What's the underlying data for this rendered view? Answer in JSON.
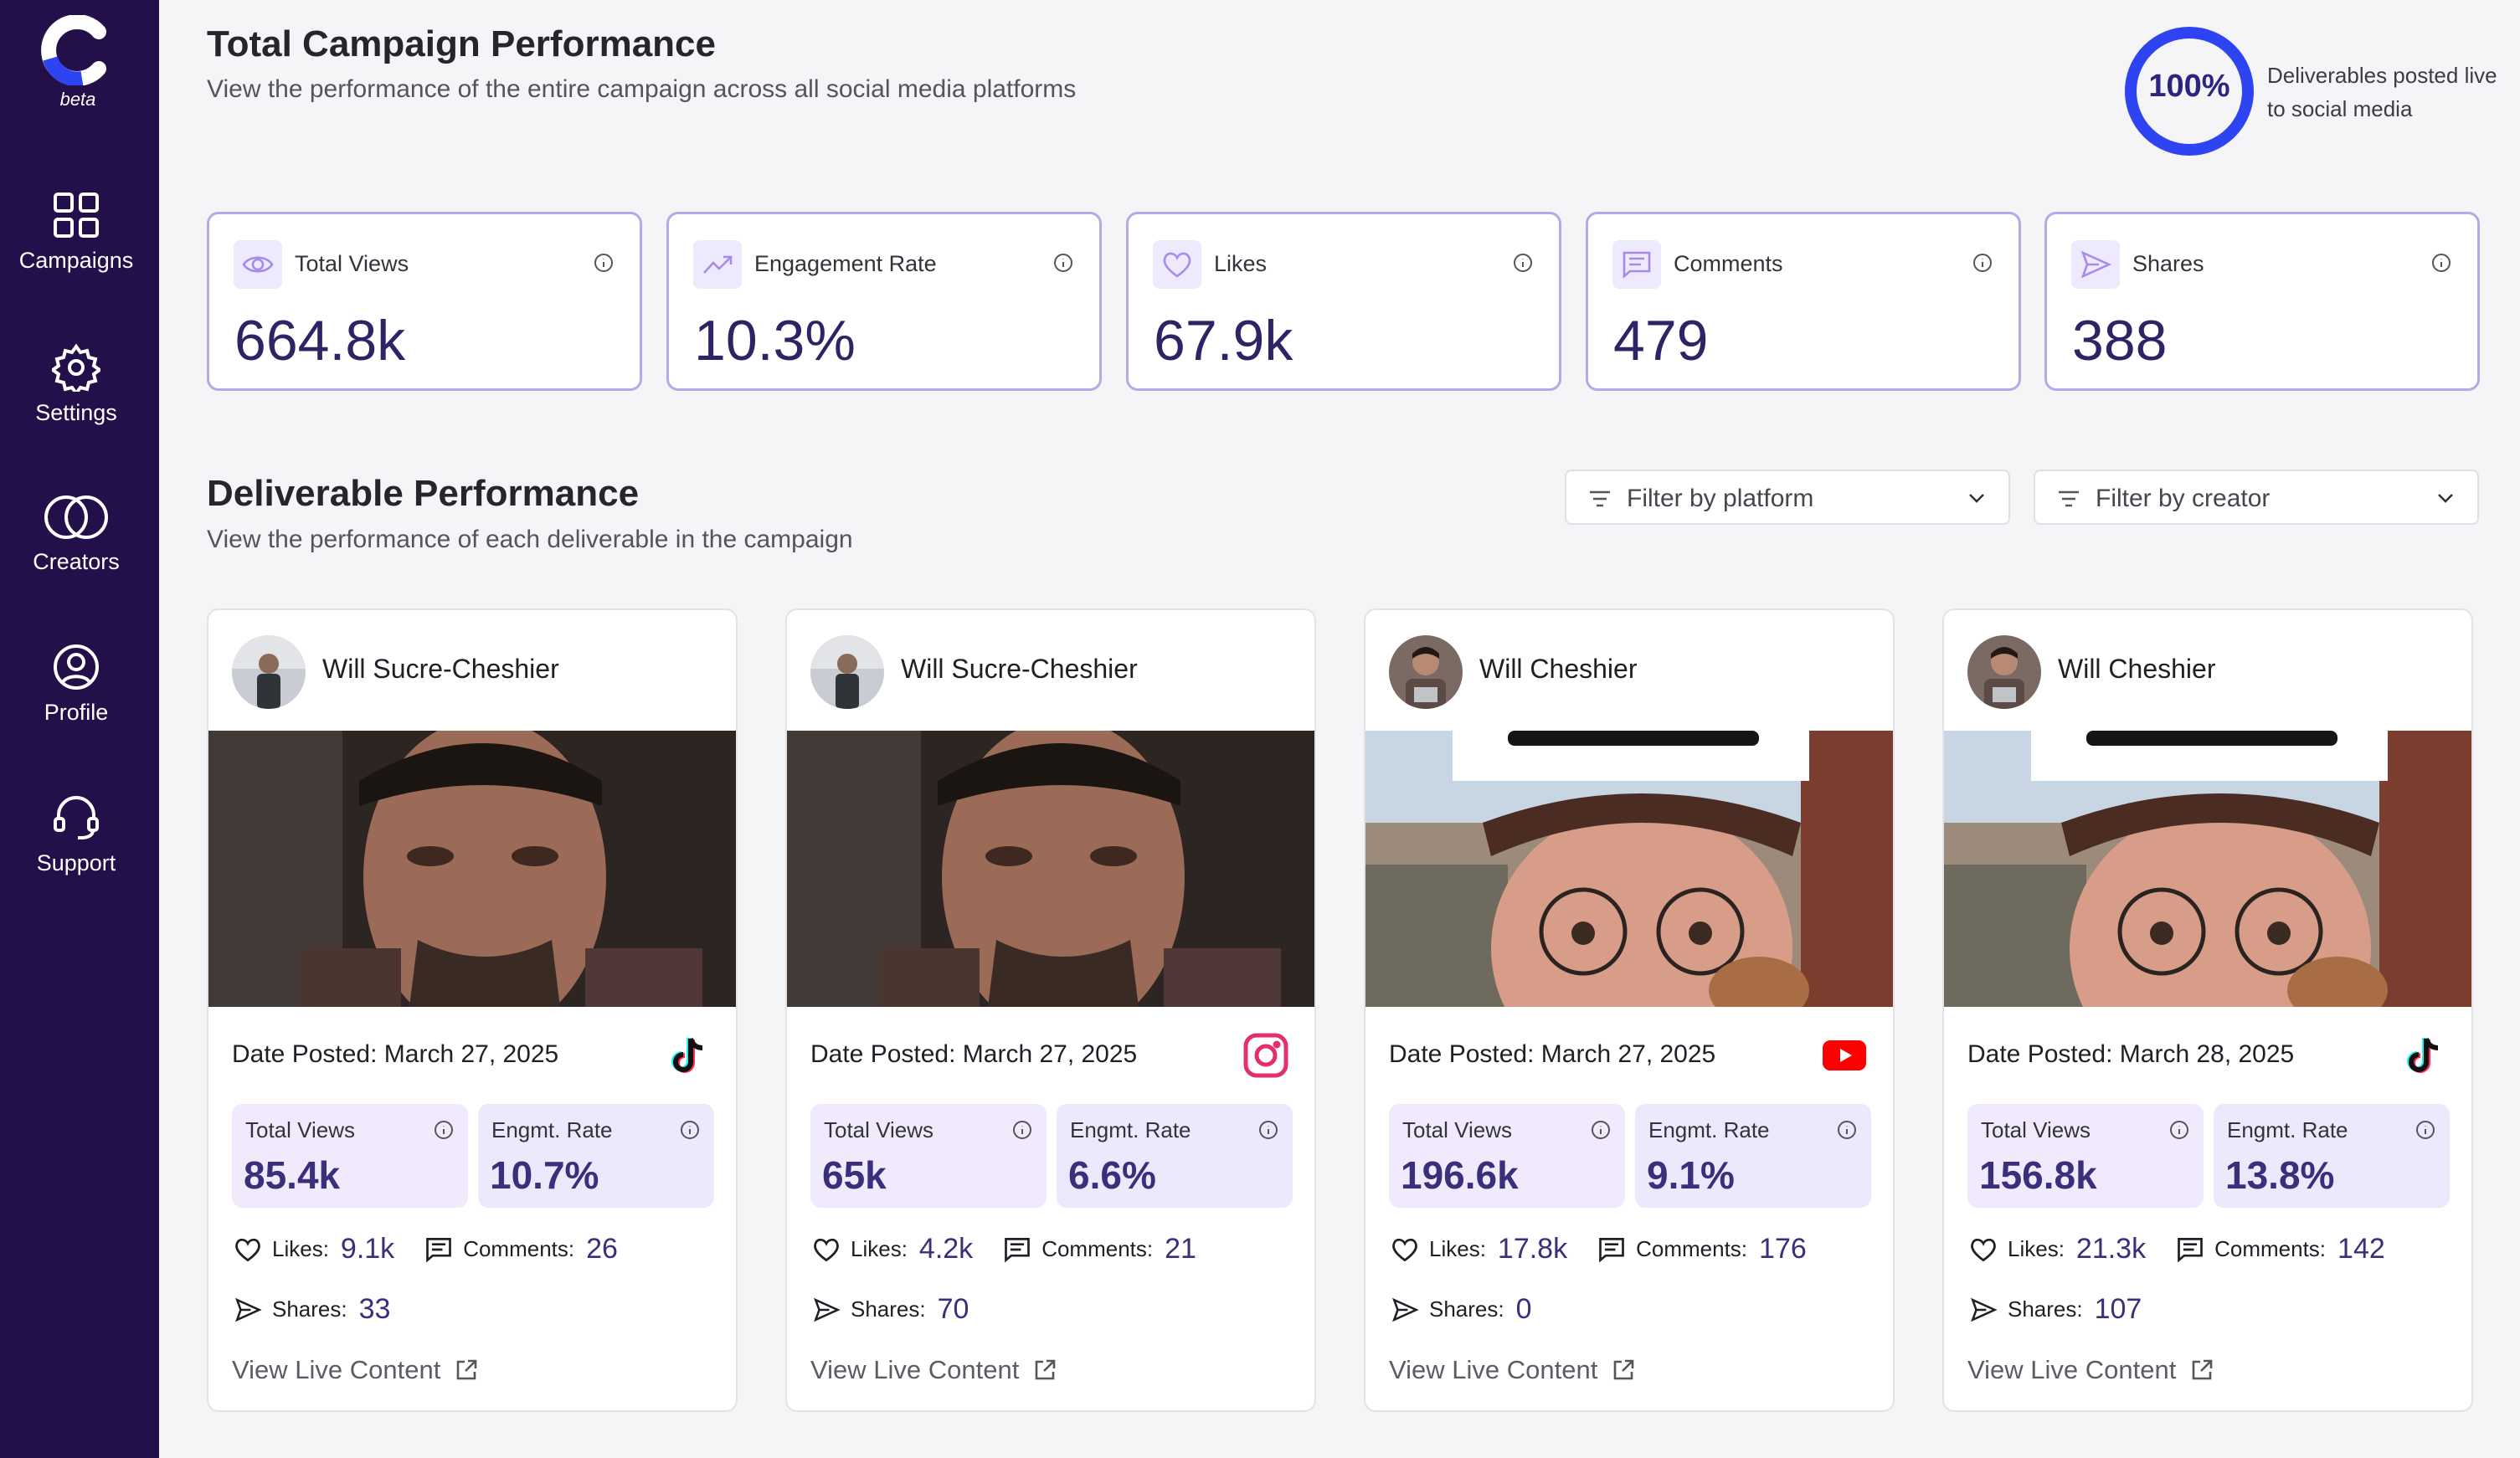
{
  "app": {
    "logo_letter": "C",
    "beta_label": "beta",
    "accent": "#2e44f2",
    "sidebar_bg": "#23104a"
  },
  "nav": [
    {
      "label": "Campaigns",
      "icon": "grid-icon"
    },
    {
      "label": "Settings",
      "icon": "gear-icon"
    },
    {
      "label": "Creators",
      "icon": "overlapping-circles-icon"
    },
    {
      "label": "Profile",
      "icon": "user-circle-icon"
    },
    {
      "label": "Support",
      "icon": "headset-icon"
    }
  ],
  "header": {
    "title": "Total Campaign Performance",
    "subtitle": "View the performance of the entire campaign across all social media platforms",
    "progress_value": "100%",
    "progress_fraction": 1.0,
    "progress_caption": "Deliverables posted live to social media"
  },
  "stats": [
    {
      "label": "Total Views",
      "value": "664.8k",
      "icon": "eye-icon"
    },
    {
      "label": "Engagement Rate",
      "value": "10.3%",
      "icon": "trending-up-icon"
    },
    {
      "label": "Likes",
      "value": "67.9k",
      "icon": "heart-icon"
    },
    {
      "label": "Comments",
      "value": "479",
      "icon": "comment-icon"
    },
    {
      "label": "Shares",
      "value": "388",
      "icon": "send-icon"
    }
  ],
  "deliverables_section": {
    "title": "Deliverable Performance",
    "subtitle": "View the performance of each deliverable in the campaign",
    "filter_platform": "Filter by platform",
    "filter_creator": "Filter by creator"
  },
  "labels": {
    "total_views": "Total Views",
    "engagement_rate": "Engmt. Rate",
    "likes": "Likes:",
    "comments": "Comments:",
    "shares": "Shares:",
    "view_live": "View Live Content"
  },
  "deliverables": [
    {
      "creator": "Will Sucre-Cheshier",
      "date": "Date Posted: March 27, 2025",
      "platform": "tiktok-icon",
      "views": "85.4k",
      "rate": "10.7%",
      "likes": "9.1k",
      "comments": "26",
      "shares": "33"
    },
    {
      "creator": "Will Sucre-Cheshier",
      "date": "Date Posted: March 27, 2025",
      "platform": "instagram-icon",
      "views": "65k",
      "rate": "6.6%",
      "likes": "4.2k",
      "comments": "21",
      "shares": "70"
    },
    {
      "creator": "Will Cheshier",
      "date": "Date Posted: March 27, 2025",
      "platform": "youtube-icon",
      "views": "196.6k",
      "rate": "9.1%",
      "likes": "17.8k",
      "comments": "176",
      "shares": "0"
    },
    {
      "creator": "Will Cheshier",
      "date": "Date Posted: March 28, 2025",
      "platform": "tiktok-icon",
      "views": "156.8k",
      "rate": "13.8%",
      "likes": "21.3k",
      "comments": "142",
      "shares": "107"
    }
  ]
}
